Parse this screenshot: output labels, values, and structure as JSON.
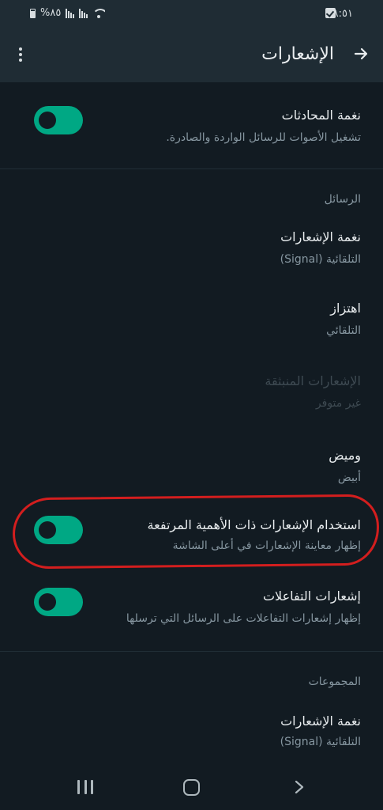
{
  "status_bar": {
    "time": "٨:٥١",
    "battery": "%٨٥"
  },
  "app_bar": {
    "title": "الإشعارات"
  },
  "conversation_tones": {
    "title": "نغمة المحادثات",
    "subtitle": "تشغيل الأصوات للرسائل الواردة والصادرة.",
    "enabled": true
  },
  "messages_section": {
    "header": "الرسائل",
    "notification_tone": {
      "title": "نغمة الإشعارات",
      "subtitle": "التلقائية (Signal)"
    },
    "vibrate": {
      "title": "اهتزاز",
      "subtitle": "التلقائي"
    },
    "popup_notification": {
      "title": "الإشعارات المنبثقة",
      "subtitle": "غير متوفر"
    },
    "light": {
      "title": "وميض",
      "subtitle": "أبيض"
    },
    "high_priority": {
      "title": "استخدام الإشعارات ذات الأهمية المرتفعة",
      "subtitle": "إظهار معاينة الإشعارات في أعلى الشاشة",
      "enabled": true
    },
    "reaction_notifications": {
      "title": "إشعارات التفاعلات",
      "subtitle": "إظهار إشعارات التفاعلات على الرسائل التي ترسلها",
      "enabled": true
    }
  },
  "groups_section": {
    "header": "المجموعات",
    "notification_tone": {
      "title": "نغمة الإشعارات",
      "subtitle": "التلقائية (Signal)"
    }
  },
  "colors": {
    "background": "#121b22",
    "app_bar": "#1f2c34",
    "accent": "#00a884",
    "highlight": "#d31e1e"
  }
}
